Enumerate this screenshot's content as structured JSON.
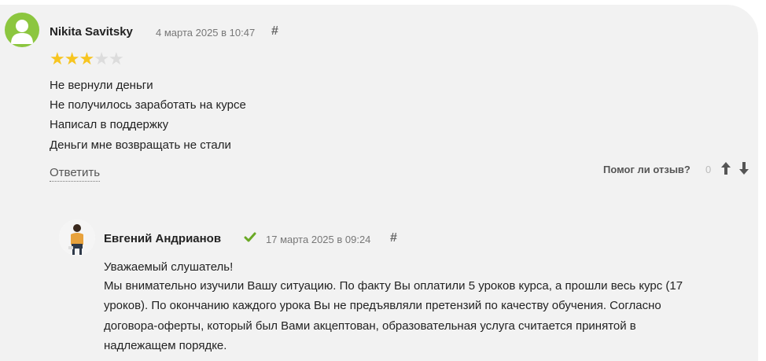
{
  "review": {
    "author": "Nikita Savitsky",
    "date": "4 марта 2025 в 10:47",
    "hash": "#",
    "rating": 3,
    "rating_max": 5,
    "lines": [
      "Не вернули деньги",
      "Не получилось заработать на курсе",
      "Написал в поддержку",
      "Деньги мне возвращать не стали"
    ],
    "reply_label": "Ответить",
    "helpful_label": "Помог ли отзыв?",
    "helpful_count": "0"
  },
  "reply": {
    "author": "Евгений Андрианов",
    "date": "17 марта 2025 в 09:24",
    "hash": "#",
    "lines": [
      "Уважаемый слушатель!",
      "Мы внимательно изучили Вашу ситуацию. По факту Вы оплатили 5 уроков курса, а прошли весь курс (17",
      "уроков). По окончанию каждого урока Вы не предъявляли претензий по качеству обучения. Согласно",
      "договора-оферты, который был Вами акцептован, образовательная услуга считается принятой в",
      "надлежащем порядке."
    ]
  },
  "colors": {
    "avatar_green": "#8cc63f",
    "star_active": "#f7c520",
    "star_inactive": "#dcdcdc",
    "verified_check": "#6aa925"
  },
  "icons": {
    "avatar": "user-silhouette-icon",
    "verified": "check-icon",
    "helpful_up": "arrow-up-icon",
    "helpful_down": "arrow-down-icon"
  }
}
